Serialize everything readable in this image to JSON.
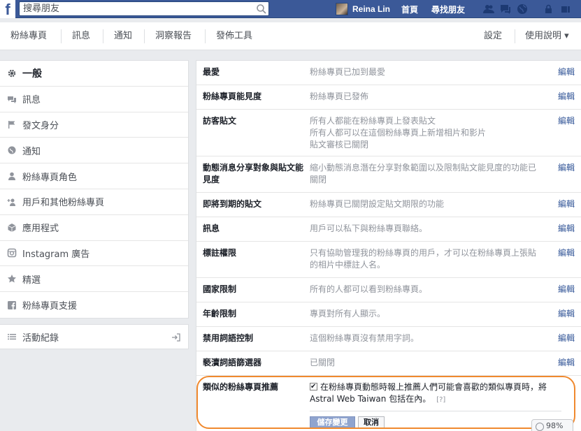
{
  "topbar": {
    "logo": "f",
    "search_placeholder": "搜尋朋友",
    "user_name": "Reina Lin",
    "home": "首頁",
    "find_friends": "尋找朋友"
  },
  "pagenav": {
    "items": [
      "粉絲專頁",
      "訊息",
      "通知",
      "洞察報告",
      "發佈工具"
    ],
    "settings": "設定",
    "help": "使用說明 ▾"
  },
  "sidebar": {
    "items": [
      {
        "label": "一般",
        "icon": "gear-icon"
      },
      {
        "label": "訊息",
        "icon": "message-icon"
      },
      {
        "label": "發文身分",
        "icon": "flag-icon"
      },
      {
        "label": "通知",
        "icon": "globe-icon"
      },
      {
        "label": "粉絲專頁角色",
        "icon": "person-icon"
      },
      {
        "label": "用戶和其他粉絲專頁",
        "icon": "add-person-icon"
      },
      {
        "label": "應用程式",
        "icon": "cube-icon"
      },
      {
        "label": "Instagram 廣告",
        "icon": "instagram-icon"
      },
      {
        "label": "精選",
        "icon": "star-icon"
      },
      {
        "label": "粉絲專頁支援",
        "icon": "facebook-icon"
      }
    ],
    "activity_log": "活動紀錄"
  },
  "settings": {
    "edit": "編輯",
    "rows": [
      {
        "label": "最愛",
        "value": "粉絲專頁已加到最愛"
      },
      {
        "label": "粉絲專頁能見度",
        "value": "粉絲專頁已發佈"
      },
      {
        "label": "訪客貼文",
        "value": "所有人都能在粉絲專頁上發表貼文\n所有人都可以在這個粉絲專頁上新增相片和影片\n貼文審核已關閉"
      },
      {
        "label": "動態消息分享對象與貼文能見度",
        "value": "縮小動態消息潛在分享對象範圍以及限制貼文能見度的功能已關閉"
      },
      {
        "label": "即將到期的貼文",
        "value": "粉絲專頁已關閉設定貼文期限的功能"
      },
      {
        "label": "訊息",
        "value": "用戶可以私下與粉絲專頁聯絡。"
      },
      {
        "label": "標註權限",
        "value": "只有協助管理我的粉絲專頁的用戶，才可以在粉絲專頁上張貼的相片中標註人名。"
      },
      {
        "label": "國家限制",
        "value": "所有的人都可以看到粉絲專頁。"
      },
      {
        "label": "年齡限制",
        "value": "專頁對所有人顯示。"
      },
      {
        "label": "禁用詞語控制",
        "value": "這個粉絲專頁沒有禁用字詞。"
      },
      {
        "label": "褻瀆詞語篩選器",
        "value": "已關閉"
      }
    ],
    "similar": {
      "label": "類似的粉絲專頁推薦",
      "checkbox_text": "在粉絲專頁動態時報上推薦人們可能會喜歡的類似專頁時，將 Astral Web Taiwan 包括在內。",
      "help": "[?]",
      "save": "儲存變更",
      "cancel": "取消"
    }
  },
  "zoom": "98%",
  "colors": {
    "brand_blue": "#3b5998",
    "link": "#365899",
    "highlight": "#f0892e"
  }
}
